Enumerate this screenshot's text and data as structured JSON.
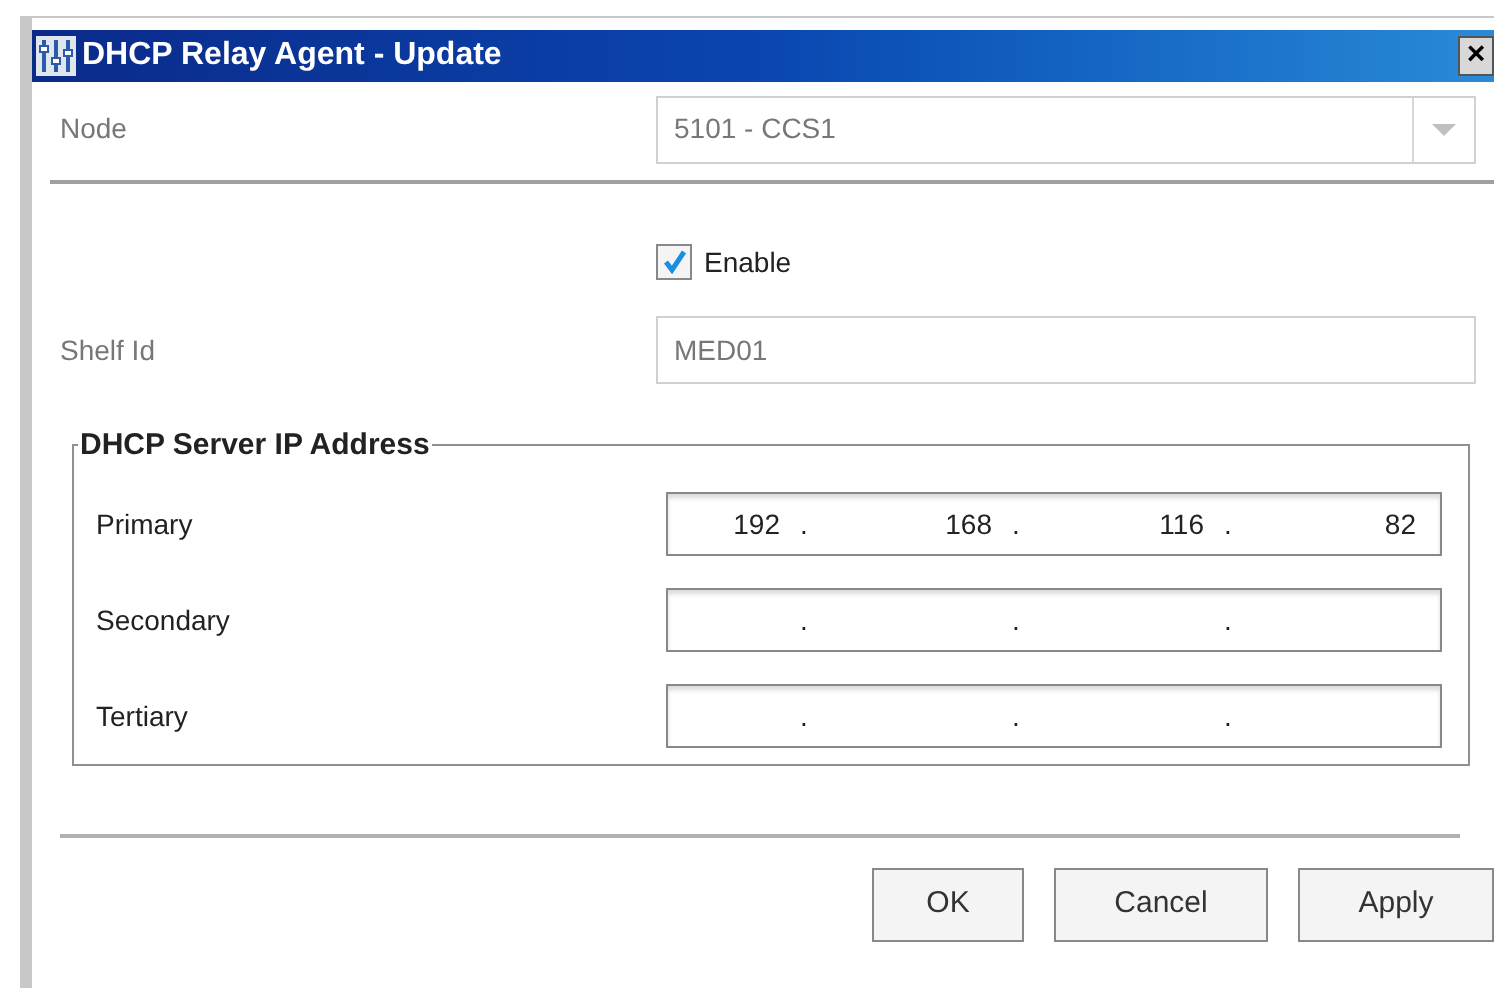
{
  "window": {
    "title": "DHCP Relay Agent - Update",
    "close": "×"
  },
  "node": {
    "label": "Node",
    "value": "5101 - CCS1",
    "disabled": true
  },
  "enable": {
    "label": "Enable",
    "checked": true
  },
  "shelf_id": {
    "label": "Shelf Id",
    "value": "MED01",
    "disabled": true
  },
  "dhcp_server": {
    "title": "DHCP Server IP Address",
    "addresses": [
      {
        "label": "Primary",
        "octets": [
          "192",
          "168",
          "116",
          "82"
        ],
        "separators": [
          ".",
          ".",
          "."
        ]
      },
      {
        "label": "Secondary",
        "separators": [
          ".",
          ".",
          "."
        ]
      },
      {
        "label": "Tertiary",
        "separators": [
          ".",
          ".",
          "."
        ]
      }
    ]
  },
  "buttons": [
    "OK",
    "Cancel",
    "Apply"
  ]
}
